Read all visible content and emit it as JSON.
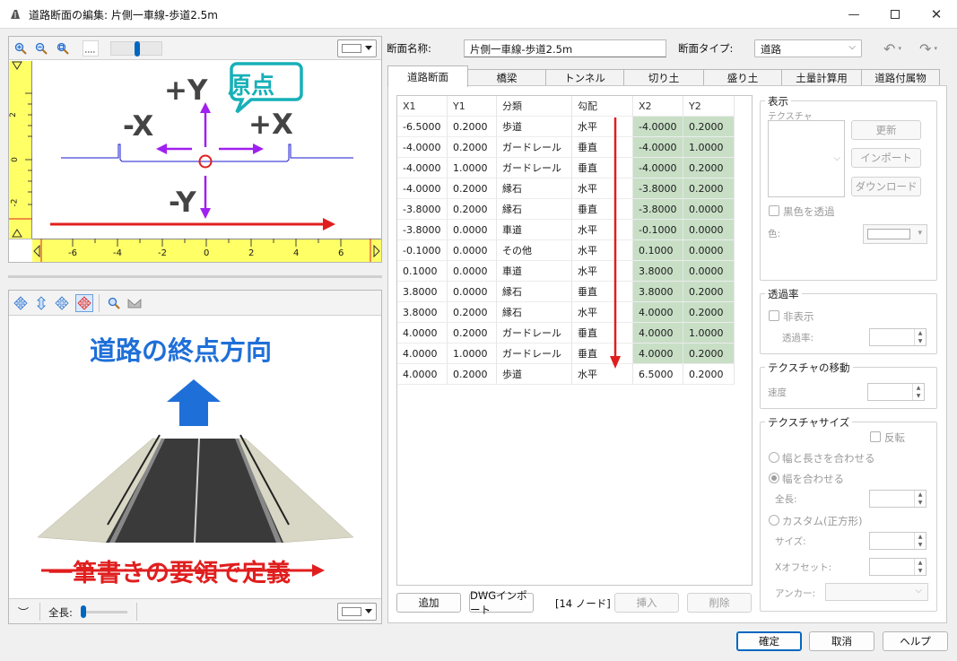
{
  "window": {
    "title": "道路断面の編集: 片側一車線-歩道2.5m",
    "minimize_icon": "minimize-icon",
    "maximize_icon": "maximize-icon",
    "close_icon": "close-icon"
  },
  "section_view": {
    "ruler_x_ticks": [
      "-6",
      "-4",
      "-2",
      "0",
      "2",
      "4",
      "6"
    ],
    "ruler_y_ticks": [
      "2",
      "0",
      "-2"
    ],
    "annotations": {
      "plus_y": "+Y",
      "minus_y": "-Y",
      "plus_x": "+X",
      "minus_x": "-X",
      "origin": "原点"
    }
  },
  "preview_view": {
    "heading": "道路の終点方向",
    "caption": "一筆書きの要領で定義",
    "length_label": "全長:"
  },
  "header": {
    "name_label": "断面名称:",
    "name_value": "片側一車線-歩道2.5m",
    "type_label": "断面タイプ:",
    "type_value": "道路"
  },
  "tabs": [
    {
      "label": "道路断面",
      "active": true
    },
    {
      "label": "橋梁"
    },
    {
      "label": "トンネル"
    },
    {
      "label": "切り土"
    },
    {
      "label": "盛り土"
    },
    {
      "label": "土量計算用"
    },
    {
      "label": "道路付属物"
    }
  ],
  "table": {
    "headers": [
      "X1",
      "Y1",
      "分類",
      "勾配",
      "X2",
      "Y2"
    ],
    "rows": [
      [
        "-6.5000",
        "0.2000",
        "歩道",
        "水平",
        "-4.0000",
        "0.2000"
      ],
      [
        "-4.0000",
        "0.2000",
        "ガードレール",
        "垂直",
        "-4.0000",
        "1.0000"
      ],
      [
        "-4.0000",
        "1.0000",
        "ガードレール",
        "垂直",
        "-4.0000",
        "0.2000"
      ],
      [
        "-4.0000",
        "0.2000",
        "縁石",
        "水平",
        "-3.8000",
        "0.2000"
      ],
      [
        "-3.8000",
        "0.2000",
        "縁石",
        "垂直",
        "-3.8000",
        "0.0000"
      ],
      [
        "-3.8000",
        "0.0000",
        "車道",
        "水平",
        "-0.1000",
        "0.0000"
      ],
      [
        "-0.1000",
        "0.0000",
        "その他",
        "水平",
        "0.1000",
        "0.0000"
      ],
      [
        "0.1000",
        "0.0000",
        "車道",
        "水平",
        "3.8000",
        "0.0000"
      ],
      [
        "3.8000",
        "0.0000",
        "縁石",
        "垂直",
        "3.8000",
        "0.2000"
      ],
      [
        "3.8000",
        "0.2000",
        "縁石",
        "水平",
        "4.0000",
        "0.2000"
      ],
      [
        "4.0000",
        "0.2000",
        "ガードレール",
        "垂直",
        "4.0000",
        "1.0000"
      ],
      [
        "4.0000",
        "1.0000",
        "ガードレール",
        "垂直",
        "4.0000",
        "0.2000"
      ],
      [
        "4.0000",
        "0.2000",
        "歩道",
        "水平",
        "6.5000",
        "0.2000"
      ]
    ]
  },
  "table_buttons": {
    "add": "追加",
    "dwg_import": "DWGインポート",
    "node_count": "[14 ノード]",
    "insert": "挿入",
    "delete": "削除"
  },
  "display_group": {
    "title": "表示",
    "texture_label": "テクスチャ",
    "update": "更新",
    "import": "インポート",
    "download": "ダウンロード",
    "black_transparent": "黒色を透過",
    "color_label": "色:"
  },
  "transparency_group": {
    "title": "透過率",
    "hide": "非表示",
    "rate_label": "透過率:"
  },
  "texture_move_group": {
    "title": "テクスチャの移動",
    "speed_label": "速度"
  },
  "texture_size_group": {
    "title": "テクスチャサイズ",
    "flip": "反転",
    "fit_width_length": "幅と長さを合わせる",
    "fit_width": "幅を合わせる",
    "length_label": "全長:",
    "custom_square": "カスタム(正方形)",
    "size_label": "サイズ:",
    "x_offset_label": "Xオフセット:",
    "anchor_label": "アンカー:"
  },
  "footer": {
    "ok": "確定",
    "cancel": "取消",
    "help": "ヘルプ"
  },
  "colors": {
    "accent_blue": "#1f6fd8",
    "red": "#e01e1e",
    "purple": "#a020f0",
    "teal": "#17b0b8",
    "green_cell": "#c8dfc6",
    "ruler_yellow": "#ffff66"
  }
}
